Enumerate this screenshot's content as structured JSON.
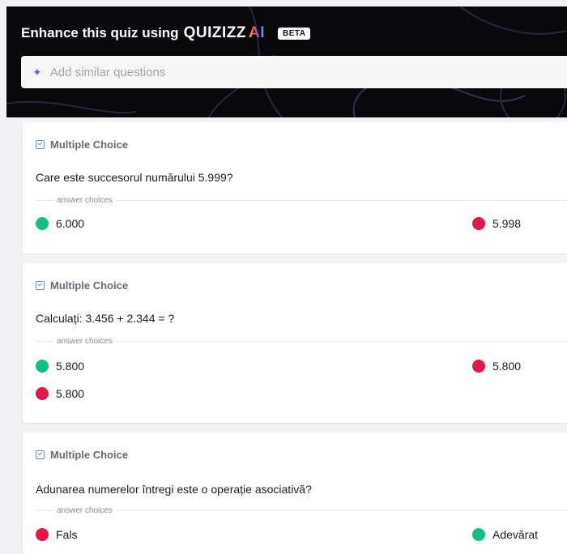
{
  "banner": {
    "title": "Enhance this quiz using",
    "brand_word": "QUIZIZZ",
    "brand_ai": "AI",
    "beta": "BETA",
    "sparkle_icon": "sparkle-icon",
    "input_placeholder": "Add similar questions"
  },
  "colors": {
    "banner_bg": "#09090b",
    "correct": "#10c285",
    "incorrect": "#e5174a",
    "ai_accent": "#8a4be8"
  },
  "questions": [
    {
      "type": "Multiple Choice",
      "text": "Care este succesorul numărului 5.999?",
      "choices_label": "answer choices",
      "answers": [
        {
          "text": "6.000",
          "status": "correct"
        },
        {
          "text": "5.998",
          "status": "incorrect"
        }
      ]
    },
    {
      "type": "Multiple Choice",
      "text": "Calculați: 3.456 + 2.344 = ?",
      "choices_label": "answer choices",
      "answers": [
        {
          "text": "5.800",
          "status": "correct"
        },
        {
          "text": "5.800",
          "status": "incorrect"
        },
        {
          "text": "5.800",
          "status": "incorrect"
        }
      ]
    },
    {
      "type": "Multiple Choice",
      "text": "Adunarea numerelor întregi este o operație asociativă?",
      "choices_label": "answer choices",
      "answers": [
        {
          "text": "Fals",
          "status": "incorrect"
        },
        {
          "text": "Adevărat",
          "status": "correct"
        }
      ]
    }
  ]
}
